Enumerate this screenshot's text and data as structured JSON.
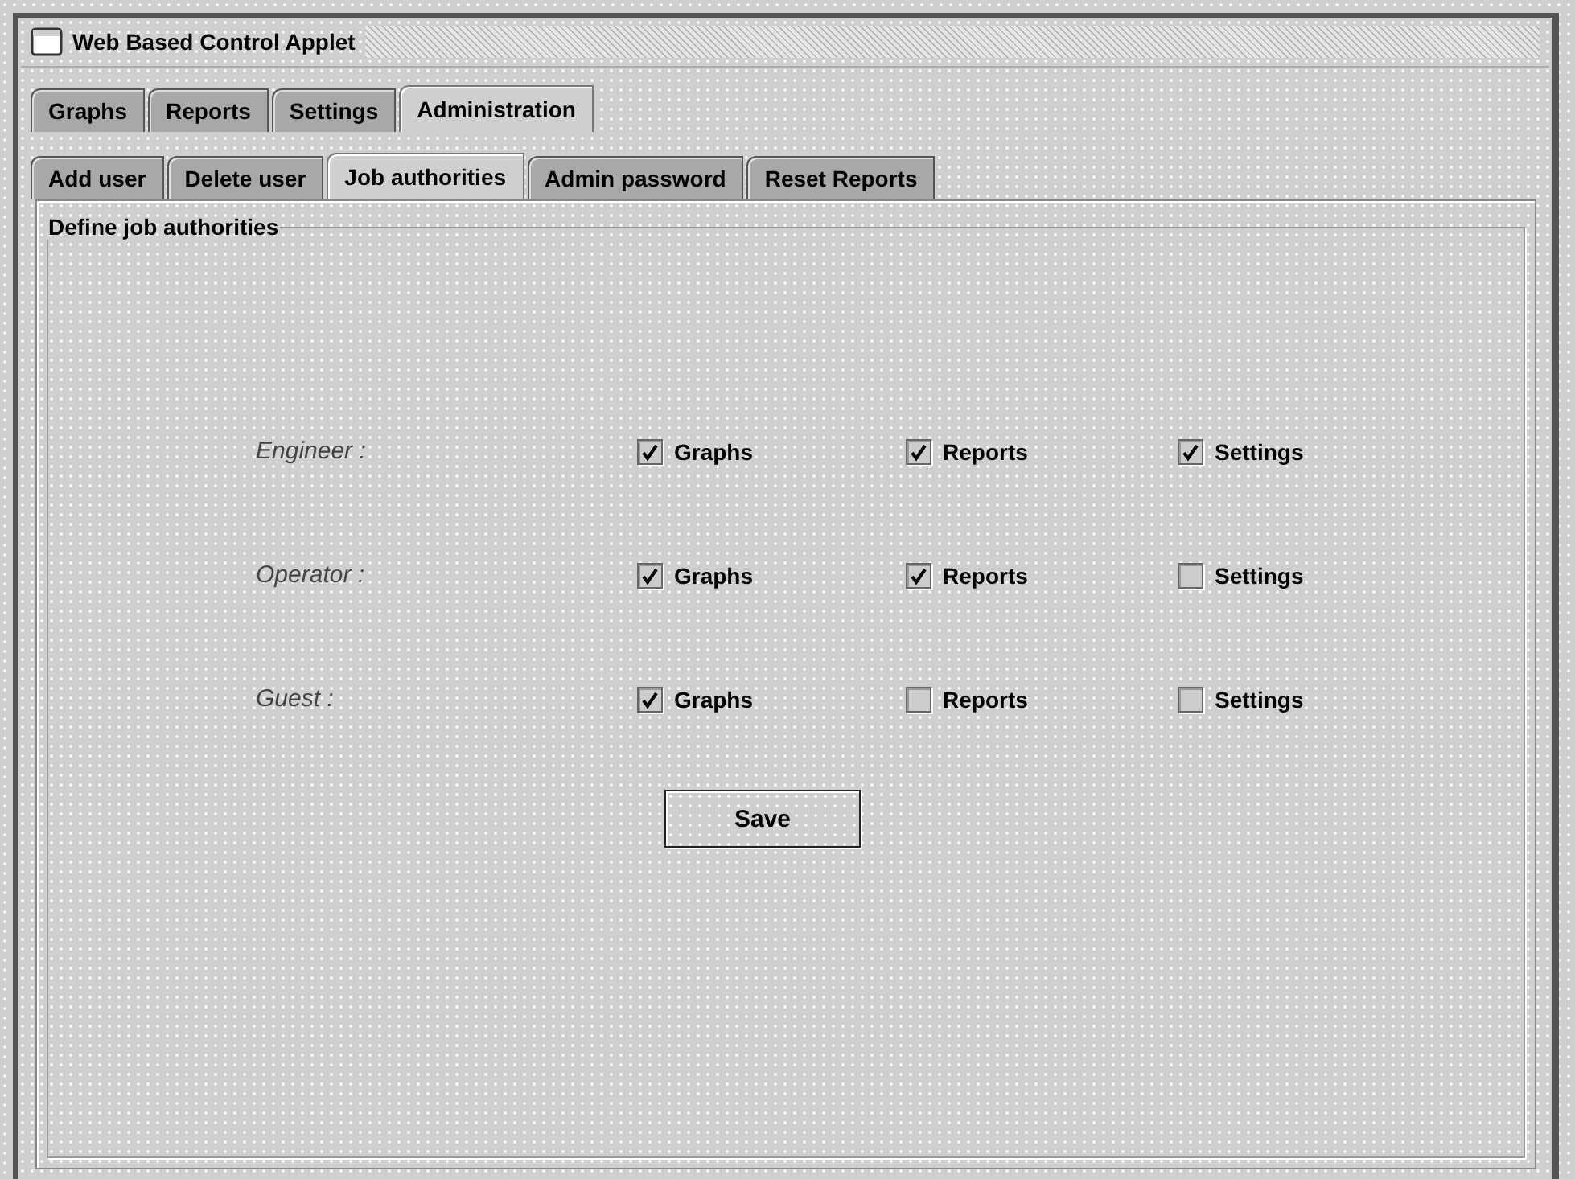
{
  "window": {
    "title": "Web Based Control Applet"
  },
  "tabs": [
    {
      "label": "Graphs",
      "selected": false
    },
    {
      "label": "Reports",
      "selected": false
    },
    {
      "label": "Settings",
      "selected": false
    },
    {
      "label": "Administration",
      "selected": true
    }
  ],
  "subtabs": [
    {
      "label": "Add user",
      "selected": false
    },
    {
      "label": "Delete user",
      "selected": false
    },
    {
      "label": "Job authorities",
      "selected": true
    },
    {
      "label": "Admin password",
      "selected": false
    },
    {
      "label": "Reset Reports",
      "selected": false
    }
  ],
  "group": {
    "title": "Define job authorities"
  },
  "roles": [
    {
      "label": "Engineer :",
      "permissions": [
        {
          "label": "Graphs",
          "checked": true
        },
        {
          "label": "Reports",
          "checked": true
        },
        {
          "label": "Settings",
          "checked": true
        }
      ]
    },
    {
      "label": "Operator :",
      "permissions": [
        {
          "label": "Graphs",
          "checked": true
        },
        {
          "label": "Reports",
          "checked": true
        },
        {
          "label": "Settings",
          "checked": false
        }
      ]
    },
    {
      "label": "Guest :",
      "permissions": [
        {
          "label": "Graphs",
          "checked": true
        },
        {
          "label": "Reports",
          "checked": false
        },
        {
          "label": "Settings",
          "checked": false
        }
      ]
    }
  ],
  "buttons": [
    {
      "label": "Save"
    }
  ]
}
